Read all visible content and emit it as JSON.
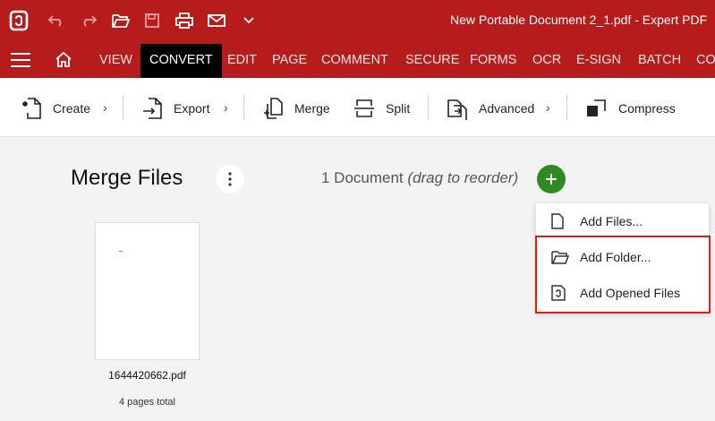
{
  "window": {
    "title": "New Portable Document 2_1.pdf  -  Expert PDF"
  },
  "quick_access": [
    "app-logo-icon",
    "undo-icon",
    "redo-icon",
    "open-folder-icon",
    "save-icon",
    "print-icon",
    "email-icon",
    "chevron-down-icon"
  ],
  "menu": {
    "tabs": [
      "VIEW",
      "CONVERT",
      "EDIT",
      "PAGE",
      "COMMENT",
      "SECURE",
      "FORMS",
      "OCR",
      "E-SIGN",
      "BATCH",
      "CO"
    ],
    "active_tab": "CONVERT"
  },
  "toolbar": {
    "create": "Create",
    "export": "Export",
    "merge": "Merge",
    "split": "Split",
    "advanced": "Advanced",
    "compress": "Compress",
    "chevron": "›"
  },
  "main": {
    "title": "Merge Files",
    "doc_count": "1 Document",
    "drag_hint": "(drag to reorder)",
    "more_icon": "more-vertical-icon",
    "add_icon": "plus-icon"
  },
  "file": {
    "name": "1644420662.pdf",
    "pages": "4 pages total"
  },
  "dropdown": {
    "add_files": "Add Files...",
    "add_folder": "Add Folder...",
    "add_opened": "Add Opened Files"
  },
  "colors": {
    "accent": "#b71c1c",
    "active_tab": "#000000",
    "add_button": "#2e8b23",
    "highlight": "#e01b1b"
  }
}
